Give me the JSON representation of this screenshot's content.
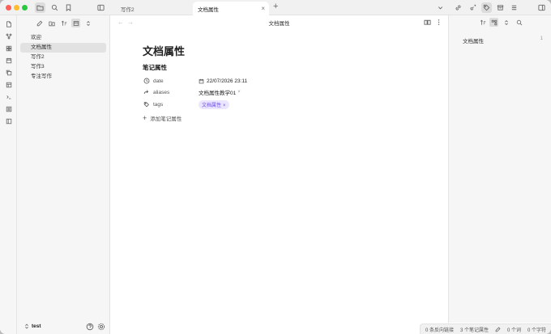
{
  "tabs": [
    {
      "label": "写作2",
      "active": false
    },
    {
      "label": "文档属性",
      "active": true
    }
  ],
  "files": [
    {
      "label": "欢迎",
      "active": false
    },
    {
      "label": "文档属性",
      "active": true
    },
    {
      "label": "写作2",
      "active": false
    },
    {
      "label": "写作3",
      "active": false
    },
    {
      "label": "专注写作",
      "active": false
    }
  ],
  "vault": {
    "name": "test"
  },
  "editor": {
    "view_title": "文档属性",
    "doc_title": "文档属性",
    "props_heading": "笔记属性",
    "properties": [
      {
        "key": "date",
        "value": "22/07/2026 23:11",
        "icon": "calendar-clock-icon"
      },
      {
        "key": "aliases",
        "value": "文档属性教学01",
        "icon": "forward-arrow-icon"
      },
      {
        "key": "tags",
        "value": "文档属性",
        "icon": "tags-icon"
      }
    ],
    "add_property": "添加笔记属性"
  },
  "right_panel": {
    "item": "文档属性",
    "count": "1"
  },
  "status": {
    "backlinks": "0 条反向链接",
    "properties": "3 个笔记属性",
    "words": "0 个词",
    "chars": "0 个字符"
  },
  "colors": {
    "tag_bg": "#ebe5ff",
    "tag_fg": "#6c4ee0",
    "close": "#ff5f57",
    "minimize": "#febc2e",
    "maximize": "#28c840"
  }
}
